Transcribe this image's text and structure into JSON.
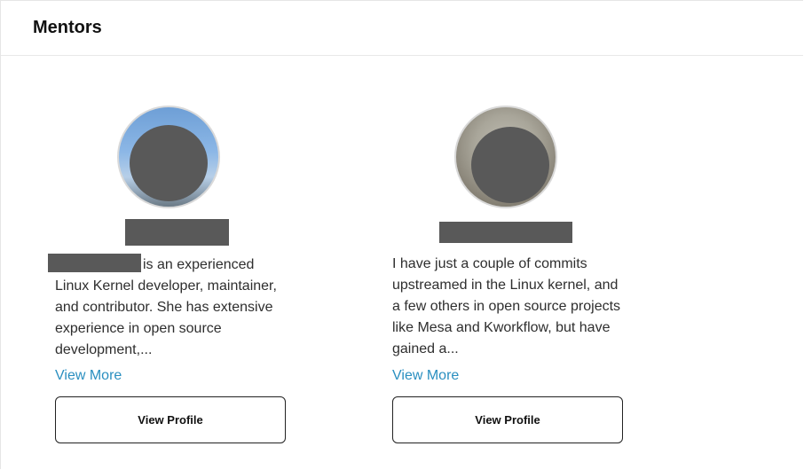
{
  "panel": {
    "title": "Mentors"
  },
  "mentors": [
    {
      "avatar_icon": "avatar-photo-redacted",
      "name_redacted": true,
      "bio": "is an experienced Linux Kernel developer, maintainer, and contributor. She has extensive experience in open source development,...",
      "view_more_label": "View More",
      "view_profile_label": "View Profile"
    },
    {
      "avatar_icon": "avatar-photo-redacted",
      "name_redacted": true,
      "bio": "I have just a couple of commits upstreamed in the Linux kernel, and a few others in open source projects like Mesa and Kworkflow, but have gained a...",
      "view_more_label": "View More",
      "view_profile_label": "View Profile"
    }
  ],
  "colors": {
    "link": "#2a8fc0",
    "redaction": "#595959",
    "button_border": "#222222"
  }
}
